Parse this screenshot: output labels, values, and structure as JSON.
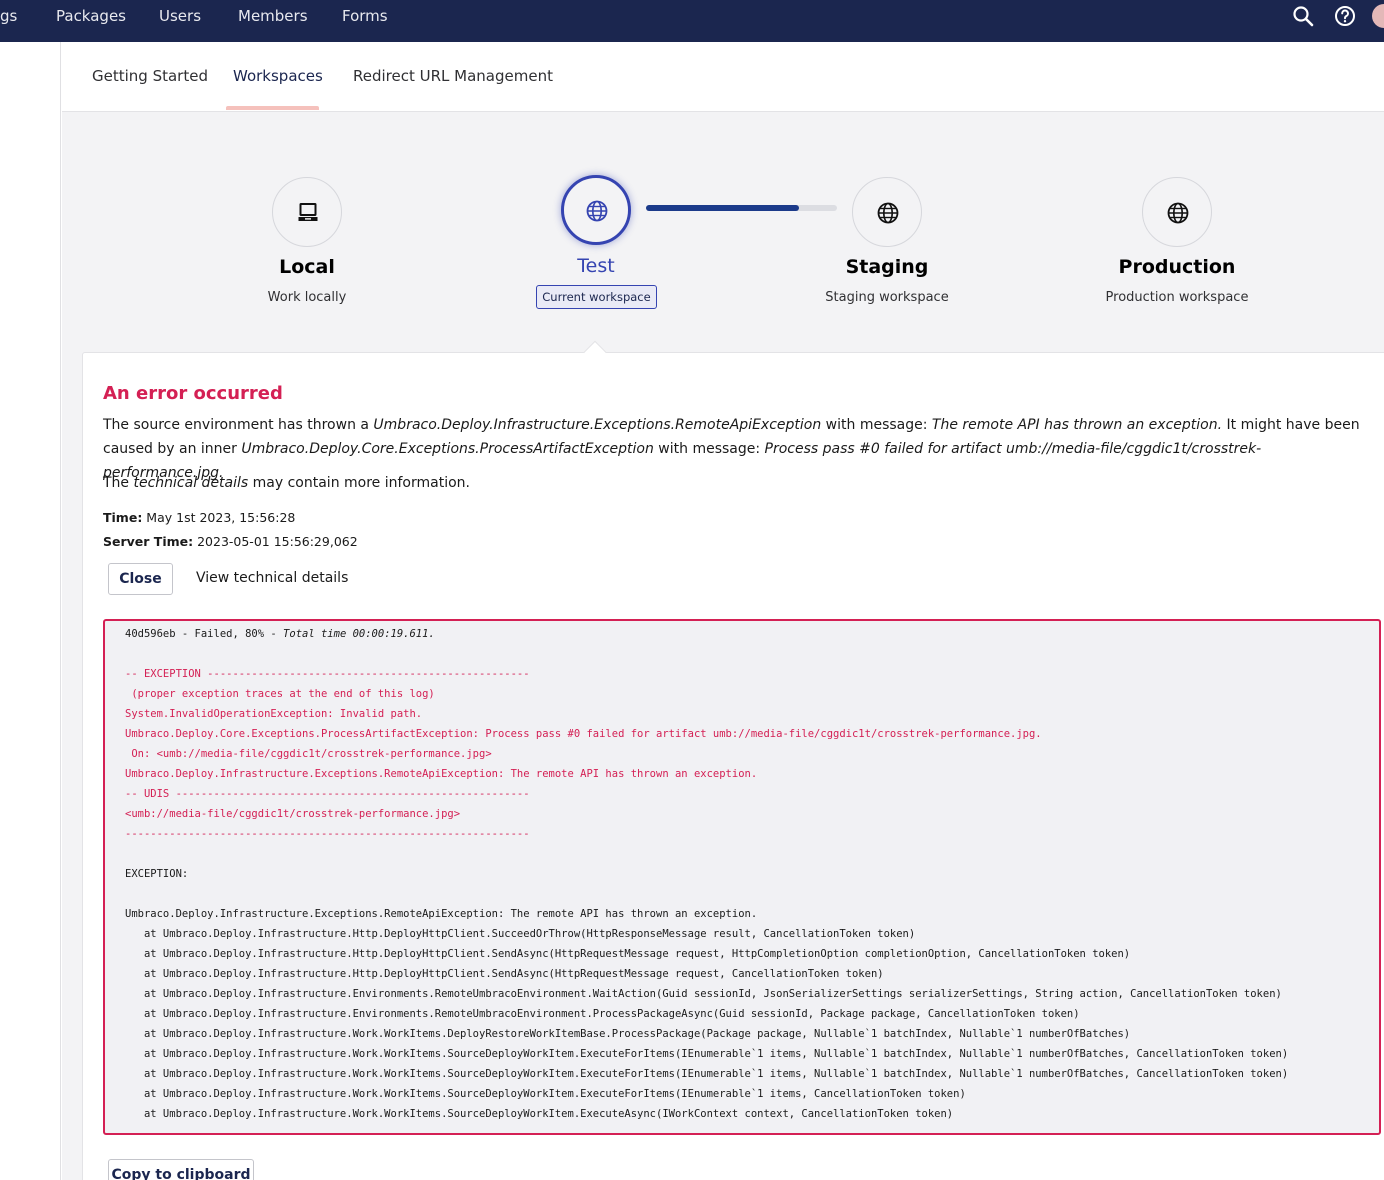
{
  "topnav": {
    "items": [
      "gs",
      "Packages",
      "Users",
      "Members",
      "Forms"
    ]
  },
  "subtabs": [
    "Getting Started",
    "Workspaces",
    "Redirect URL Management"
  ],
  "workspaces": [
    {
      "name": "Local",
      "description": "Work locally",
      "icon": "computer-icon"
    },
    {
      "name": "Test",
      "description": "",
      "badge": "Current workspace",
      "icon": "globe-icon"
    },
    {
      "name": "Staging",
      "description": "Staging workspace",
      "icon": "globe-icon"
    },
    {
      "name": "Production",
      "description": "Production workspace",
      "icon": "globe-icon"
    }
  ],
  "progress": {
    "percent": 80
  },
  "error": {
    "title": "An error occurred",
    "msg_p1": "The source environment has thrown a ",
    "msg_ex1": "Umbraco.Deploy.Infrastructure.Exceptions.RemoteApiException",
    "msg_p2": " with message: ",
    "msg_m1": "The remote API has thrown an exception.",
    "msg_p3": " It might have been caused by an inner ",
    "msg_ex2": "Umbraco.Deploy.Core.Exceptions.ProcessArtifactException",
    "msg_p4": " with message: ",
    "msg_m2": "Process pass #0 failed for artifact umb://media-file/cggdic1t/crosstrek-performance.jpg.",
    "details_p1": "The ",
    "details_em": "technical details",
    "details_p2": " may contain more information.",
    "time_label": "Time:",
    "time_value": " May 1st 2023, 15:56:28",
    "server_time_label": "Server Time:",
    "server_time_value": " 2023-05-01 15:56:29,062",
    "close_label": "Close",
    "view_details_label": "View technical details",
    "copy_label": "Copy to clipboard"
  },
  "log": {
    "first_prefix": "40d596eb - Failed, 80% - ",
    "first_italic": "Total time 00:00:19.611.",
    "lines": [
      {
        "text": "-- EXCEPTION ---------------------------------------------------",
        "red": true
      },
      {
        "text": " (proper exception traces at the end of this log)",
        "red": true
      },
      {
        "text": "System.InvalidOperationException: Invalid path.",
        "red": true
      },
      {
        "text": "Umbraco.Deploy.Core.Exceptions.ProcessArtifactException: Process pass #0 failed for artifact umb://media-file/cggdic1t/crosstrek-performance.jpg.",
        "red": true
      },
      {
        "text": " On: <umb://media-file/cggdic1t/crosstrek-performance.jpg>",
        "red": true
      },
      {
        "text": "Umbraco.Deploy.Infrastructure.Exceptions.RemoteApiException: The remote API has thrown an exception.",
        "red": true
      },
      {
        "text": "-- UDIS --------------------------------------------------------",
        "red": true
      },
      {
        "text": "<umb://media-file/cggdic1t/crosstrek-performance.jpg>",
        "red": true
      },
      {
        "text": "----------------------------------------------------------------",
        "red": true
      },
      {
        "text": "",
        "red": false
      },
      {
        "text": "EXCEPTION:",
        "red": false
      },
      {
        "text": "",
        "red": false
      },
      {
        "text": "Umbraco.Deploy.Infrastructure.Exceptions.RemoteApiException: The remote API has thrown an exception.",
        "red": false
      },
      {
        "text": "   at Umbraco.Deploy.Infrastructure.Http.DeployHttpClient.SucceedOrThrow(HttpResponseMessage result, CancellationToken token)",
        "red": false
      },
      {
        "text": "   at Umbraco.Deploy.Infrastructure.Http.DeployHttpClient.SendAsync(HttpRequestMessage request, HttpCompletionOption completionOption, CancellationToken token)",
        "red": false
      },
      {
        "text": "   at Umbraco.Deploy.Infrastructure.Http.DeployHttpClient.SendAsync(HttpRequestMessage request, CancellationToken token)",
        "red": false
      },
      {
        "text": "   at Umbraco.Deploy.Infrastructure.Environments.RemoteUmbracoEnvironment.WaitAction(Guid sessionId, JsonSerializerSettings serializerSettings, String action, CancellationToken token)",
        "red": false
      },
      {
        "text": "   at Umbraco.Deploy.Infrastructure.Environments.RemoteUmbracoEnvironment.ProcessPackageAsync(Guid sessionId, Package package, CancellationToken token)",
        "red": false
      },
      {
        "text": "   at Umbraco.Deploy.Infrastructure.Work.WorkItems.DeployRestoreWorkItemBase.ProcessPackage(Package package, Nullable`1 batchIndex, Nullable`1 numberOfBatches)",
        "red": false
      },
      {
        "text": "   at Umbraco.Deploy.Infrastructure.Work.WorkItems.SourceDeployWorkItem.ExecuteForItems(IEnumerable`1 items, Nullable`1 batchIndex, Nullable`1 numberOfBatches, CancellationToken token)",
        "red": false
      },
      {
        "text": "   at Umbraco.Deploy.Infrastructure.Work.WorkItems.SourceDeployWorkItem.ExecuteForItems(IEnumerable`1 items, Nullable`1 batchIndex, Nullable`1 numberOfBatches, CancellationToken token)",
        "red": false
      },
      {
        "text": "   at Umbraco.Deploy.Infrastructure.Work.WorkItems.SourceDeployWorkItem.ExecuteForItems(IEnumerable`1 items, CancellationToken token)",
        "red": false
      },
      {
        "text": "   at Umbraco.Deploy.Infrastructure.Work.WorkItems.SourceDeployWorkItem.ExecuteAsync(IWorkContext context, CancellationToken token)",
        "red": false
      }
    ]
  }
}
